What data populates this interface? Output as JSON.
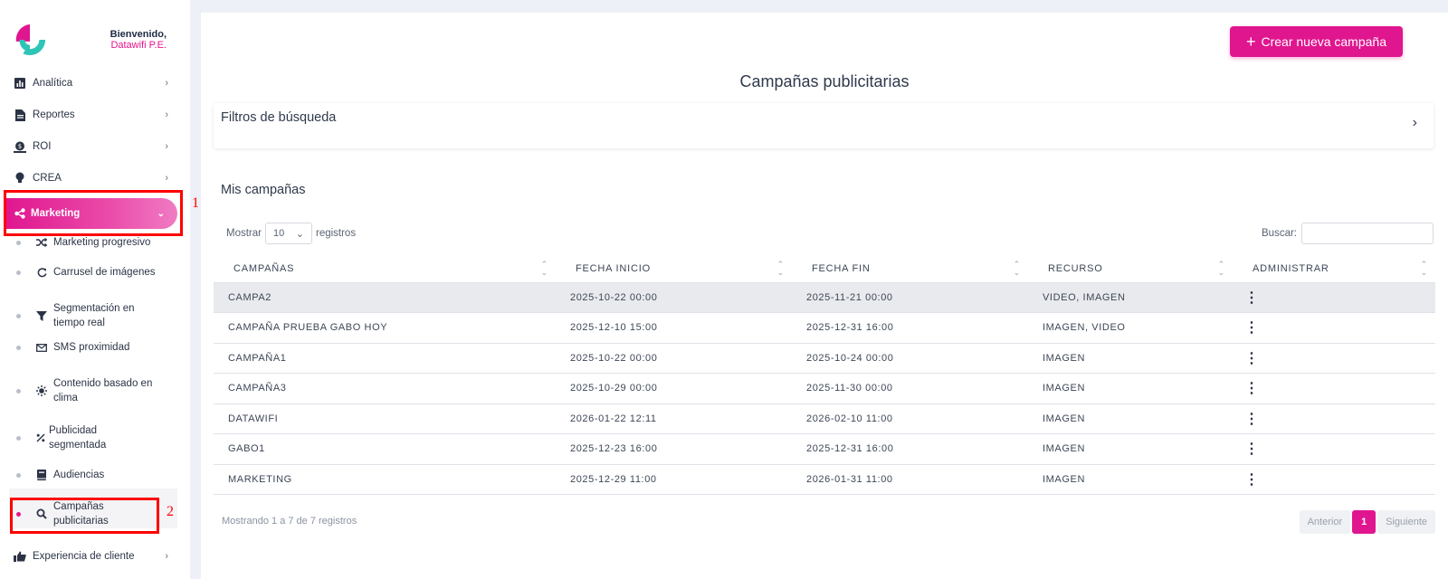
{
  "sidebar": {
    "welcome": "Bienvenido,",
    "user": "Datawifi P.E.",
    "items": [
      {
        "label": "Analítica",
        "icon": "bar-chart-icon"
      },
      {
        "label": "Reportes",
        "icon": "document-icon"
      },
      {
        "label": "ROI",
        "icon": "money-icon"
      },
      {
        "label": "CREA",
        "icon": "lightbulb-icon"
      }
    ],
    "active": {
      "label": "Marketing",
      "icon": "share-icon"
    },
    "sub_items": [
      {
        "label": "Marketing progresivo",
        "icon": "shuffle-icon"
      },
      {
        "label": "Carrusel de imágenes",
        "icon": "refresh-icon"
      },
      {
        "label": "Segmentación en tiempo real",
        "icon": "filter-icon"
      },
      {
        "label": "SMS proximidad",
        "icon": "envelope-icon"
      },
      {
        "label": "Contenido basado en clima",
        "icon": "sun-icon"
      },
      {
        "label": "Publicidad segmentada",
        "icon": "percent-icon"
      },
      {
        "label": "Audiencias",
        "icon": "book-icon"
      },
      {
        "label": "Campañas publicitarias",
        "icon": "search-icon"
      }
    ],
    "bottom": {
      "label": "Experiencia de cliente",
      "icon": "thumbs-up-icon"
    },
    "annotations": [
      "1",
      "2"
    ]
  },
  "main": {
    "create_button": "Crear nueva campaña",
    "title": "Campañas publicitarias",
    "filters_label": "Filtros de búsqueda",
    "section_title": "Mis campañas",
    "show_label": "Mostrar",
    "page_length": "10",
    "records_label": "registros",
    "search_label": "Buscar:",
    "columns": [
      "CAMPAÑAS",
      "FECHA INICIO",
      "FECHA FIN",
      "RECURSO",
      "ADMINISTRAR"
    ],
    "rows": [
      [
        "CAMPA2",
        "2025-10-22 00:00",
        "2025-11-21 00:00",
        "VIDEO, IMAGEN"
      ],
      [
        "CAMPAÑA PRUEBA GABO HOY",
        "2025-12-10 15:00",
        "2025-12-31 16:00",
        "IMAGEN, VIDEO"
      ],
      [
        "CAMPAÑA1",
        "2025-10-22 00:00",
        "2025-10-24 00:00",
        "IMAGEN"
      ],
      [
        "CAMPAÑA3",
        "2025-10-29 00:00",
        "2025-11-30 00:00",
        "IMAGEN"
      ],
      [
        "DATAWIFI",
        "2026-01-22 12:11",
        "2026-02-10 11:00",
        "IMAGEN"
      ],
      [
        "GABO1",
        "2025-12-23 16:00",
        "2025-12-31 16:00",
        "IMAGEN"
      ],
      [
        "MARKETING",
        "2025-12-29 11:00",
        "2026-01-31 11:00",
        "IMAGEN"
      ]
    ],
    "info": "Mostrando 1 a 7 de 7 registros",
    "pager": {
      "prev": "Anterior",
      "current": "1",
      "next": "Siguiente"
    }
  },
  "colors": {
    "accent": "#e0168f",
    "teal": "#2ec4b6",
    "annotation": "#ff0000"
  }
}
